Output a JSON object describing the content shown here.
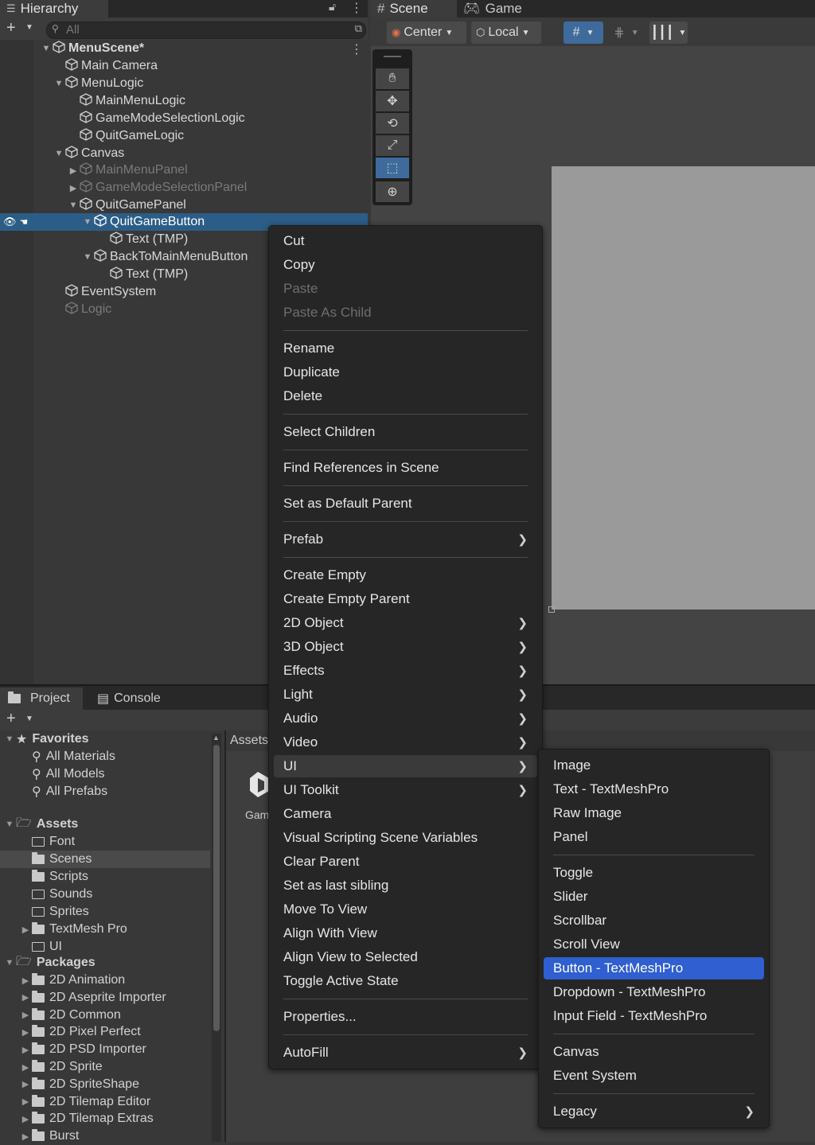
{
  "hierarchy": {
    "tab_label": "Hierarchy",
    "search_placeholder": "All",
    "rows": [
      {
        "label": "MenuScene*",
        "depth": 0,
        "expanded": true
      },
      {
        "label": "Main Camera"
      },
      {
        "label": "MenuLogic"
      },
      {
        "label": "MainMenuLogic"
      },
      {
        "label": "GameModeSelectionLogic"
      },
      {
        "label": "QuitGameLogic"
      },
      {
        "label": "Canvas"
      },
      {
        "label": "MainMenuPanel"
      },
      {
        "label": "GameModeSelectionPanel"
      },
      {
        "label": "QuitGamePanel"
      },
      {
        "label": "QuitGameButton",
        "selected": true
      },
      {
        "label": "Text (TMP)"
      },
      {
        "label": "BackToMainMenuButton"
      },
      {
        "label": "Text (TMP)"
      },
      {
        "label": "EventSystem"
      },
      {
        "label": "Logic"
      }
    ]
  },
  "scene_tabs": {
    "scene_label": "Scene",
    "game_label": "Game",
    "pivot_label": "Center",
    "space_label": "Local"
  },
  "context_menu": {
    "items": [
      {
        "label": "Cut"
      },
      {
        "label": "Copy"
      },
      {
        "label": "Paste",
        "disabled": true
      },
      {
        "label": "Paste As Child",
        "disabled": true
      },
      {
        "label": "Rename"
      },
      {
        "label": "Duplicate"
      },
      {
        "label": "Delete"
      },
      {
        "label": "Select Children"
      },
      {
        "label": "Find References in Scene"
      },
      {
        "label": "Set as Default Parent"
      },
      {
        "label": "Prefab",
        "submenu": true
      },
      {
        "label": "Create Empty"
      },
      {
        "label": "Create Empty Parent"
      },
      {
        "label": "2D Object",
        "submenu": true
      },
      {
        "label": "3D Object",
        "submenu": true
      },
      {
        "label": "Effects",
        "submenu": true
      },
      {
        "label": "Light",
        "submenu": true
      },
      {
        "label": "Audio",
        "submenu": true
      },
      {
        "label": "Video",
        "submenu": true
      },
      {
        "label": "UI",
        "submenu": true,
        "hover": true
      },
      {
        "label": "UI Toolkit",
        "submenu": true
      },
      {
        "label": "Camera"
      },
      {
        "label": "Visual Scripting Scene Variables"
      },
      {
        "label": "Clear Parent"
      },
      {
        "label": "Set as last sibling"
      },
      {
        "label": "Move To View"
      },
      {
        "label": "Align With View"
      },
      {
        "label": "Align View to Selected"
      },
      {
        "label": "Toggle Active State"
      },
      {
        "label": "Properties..."
      },
      {
        "label": "AutoFill",
        "submenu": true
      }
    ]
  },
  "ui_submenu": {
    "items": [
      {
        "label": "Image"
      },
      {
        "label": "Text - TextMeshPro"
      },
      {
        "label": "Raw Image"
      },
      {
        "label": "Panel"
      },
      {
        "label": "Toggle"
      },
      {
        "label": "Slider"
      },
      {
        "label": "Scrollbar"
      },
      {
        "label": "Scroll View"
      },
      {
        "label": "Button - TextMeshPro",
        "highlighted": true
      },
      {
        "label": "Dropdown - TextMeshPro"
      },
      {
        "label": "Input Field - TextMeshPro"
      },
      {
        "label": "Canvas"
      },
      {
        "label": "Event System"
      },
      {
        "label": "Legacy",
        "submenu": true
      }
    ]
  },
  "project": {
    "project_tab": "Project",
    "console_tab": "Console",
    "breadcrumb": "Assets",
    "asset_preview_label": "Gam",
    "favorites_label": "Favorites",
    "favorites": [
      "All Materials",
      "All Models",
      "All Prefabs"
    ],
    "assets_label": "Assets",
    "assets": [
      "Font",
      "Scenes",
      "Scripts",
      "Sounds",
      "Sprites",
      "TextMesh Pro",
      "UI"
    ],
    "packages_label": "Packages",
    "packages": [
      "2D Animation",
      "2D Aseprite Importer",
      "2D Common",
      "2D Pixel Perfect",
      "2D PSD Importer",
      "2D Sprite",
      "2D SpriteShape",
      "2D Tilemap Editor",
      "2D Tilemap Extras",
      "Burst"
    ]
  }
}
